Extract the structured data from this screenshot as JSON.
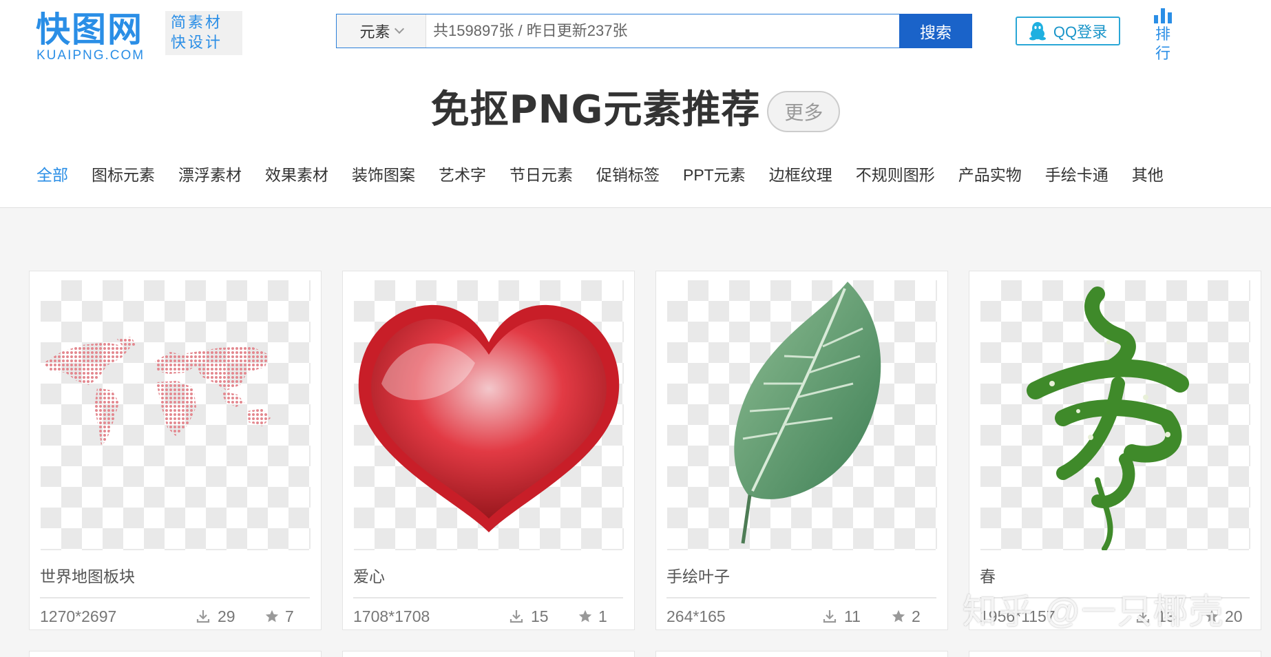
{
  "logo": {
    "main": "快图网",
    "sub": "KUAIPNG.COM",
    "slogan_line1": "简素材",
    "slogan_line2": "快设计"
  },
  "search": {
    "type_label": "元素",
    "placeholder": "共159897张 / 昨日更新237张",
    "button_label": "搜索"
  },
  "login": {
    "label": "QQ登录"
  },
  "rank": {
    "label": "排行"
  },
  "section": {
    "title": "免抠PNG元素推荐",
    "more_label": "更多"
  },
  "categories": [
    {
      "label": "全部",
      "active": true
    },
    {
      "label": "图标元素"
    },
    {
      "label": "漂浮素材"
    },
    {
      "label": "效果素材"
    },
    {
      "label": "装饰图案"
    },
    {
      "label": "艺术字"
    },
    {
      "label": "节日元素"
    },
    {
      "label": "促销标签"
    },
    {
      "label": "PPT元素"
    },
    {
      "label": "边框纹理"
    },
    {
      "label": "不规则图形"
    },
    {
      "label": "产品实物"
    },
    {
      "label": "手绘卡通"
    },
    {
      "label": "其他"
    }
  ],
  "cards": [
    {
      "title": "世界地图板块",
      "dims": "1270*2697",
      "downloads": "29",
      "favorites": "7",
      "image": "world-map"
    },
    {
      "title": "爱心",
      "dims": "1708*1708",
      "downloads": "15",
      "favorites": "1",
      "image": "heart"
    },
    {
      "title": "手绘叶子",
      "dims": "264*165",
      "downloads": "11",
      "favorites": "2",
      "image": "leaf"
    },
    {
      "title": "春",
      "dims": "1956*1157",
      "downloads": "13",
      "favorites": "20",
      "image": "spring-calligraphy"
    }
  ],
  "watermark": "知乎 @一只椰壳",
  "colors": {
    "brand_blue": "#2a8ee6",
    "search_button": "#1a63c9",
    "qq_border": "#29a6d6"
  }
}
